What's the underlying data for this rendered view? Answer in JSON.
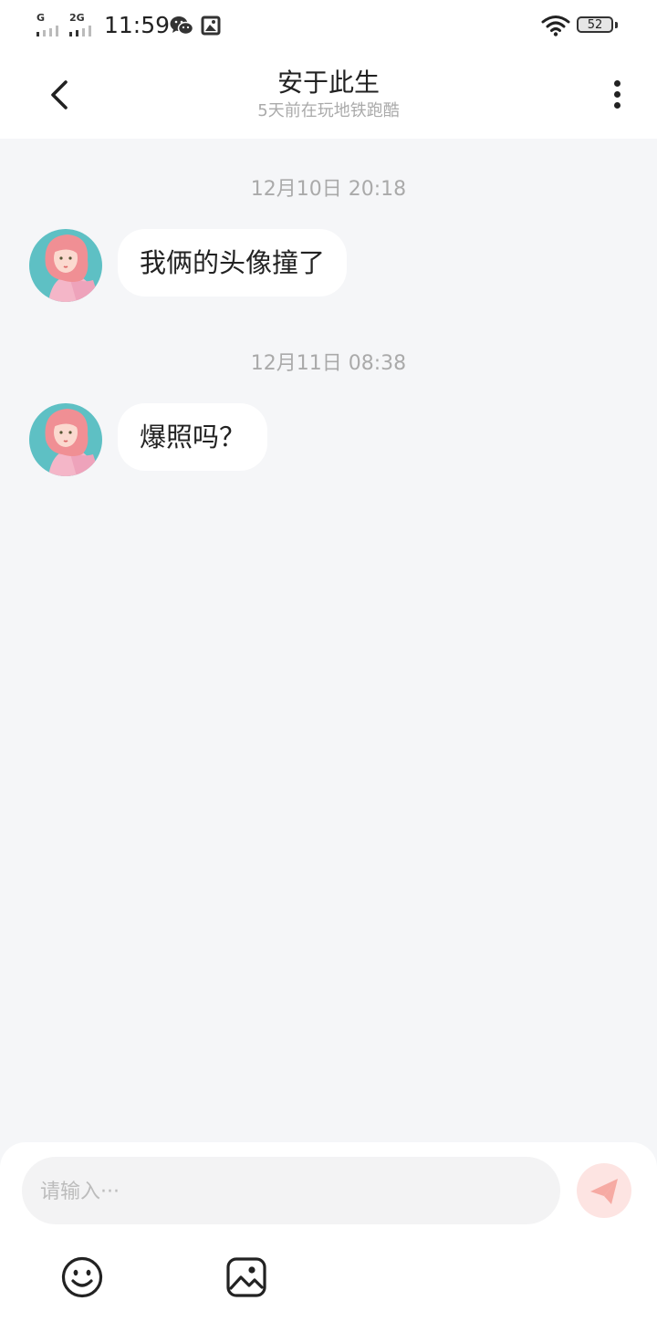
{
  "status_bar": {
    "sim1": "G",
    "sim2": "2G",
    "time": "11:59",
    "battery": "52",
    "icons": [
      "wechat-icon",
      "photo-icon",
      "wifi-icon",
      "battery-icon"
    ]
  },
  "header": {
    "title": "安于此生",
    "subtitle": "5天前在玩地铁跑酷",
    "icons": [
      "back-arrow-icon",
      "more-vertical-icon"
    ]
  },
  "messages": [
    {
      "timestamp": "12月10日 20:18",
      "text": "我俩的头像撞了"
    },
    {
      "timestamp": "12月11日 08:38",
      "text": "爆照吗？"
    }
  ],
  "composer": {
    "placeholder": "请输入···",
    "value": "",
    "icons": [
      "send-icon",
      "emoji-icon",
      "image-icon"
    ]
  },
  "colors": {
    "background": "#f5f6f8",
    "bubble": "#ffffff",
    "send_button": "#fde4e2",
    "send_icon": "#f49a92"
  }
}
